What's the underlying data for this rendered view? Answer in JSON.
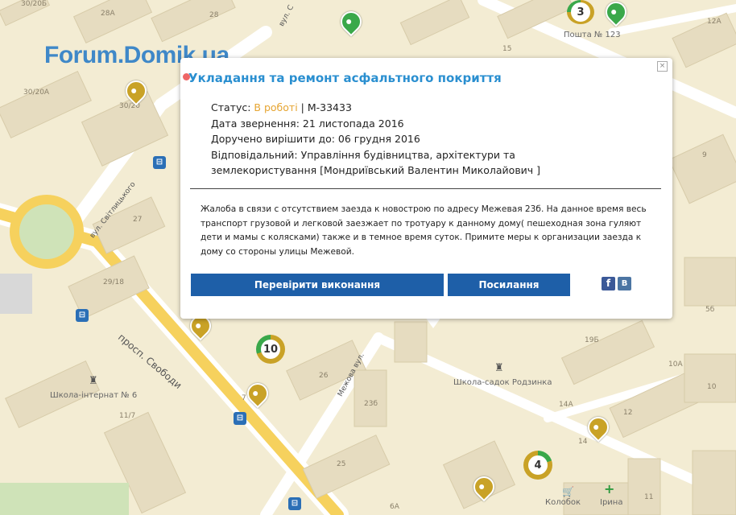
{
  "watermark": "Forum.Domik.ua",
  "map": {
    "house_numbers": [
      "30/20Б",
      "28А",
      "28",
      "30/20А",
      "30/20",
      "27",
      "29/18",
      "11/7",
      "26",
      "23б",
      "25",
      "6А",
      "15",
      "12А",
      "9",
      "19Б",
      "10А",
      "10",
      "14А",
      "12",
      "14",
      "11",
      "5б",
      "7"
    ],
    "streets": [
      "вул. Світлицького",
      "просп. Свободи",
      "Межова вул.",
      "вул. С"
    ],
    "pois": {
      "post_office": "Пошта № 123",
      "school": "Школа-інтернат № 6",
      "kindergarten": "Школа-садок Родзинка",
      "store": "Колобок",
      "pharmacy": "Ірина"
    },
    "clusters": [
      "3",
      "10",
      "4"
    ]
  },
  "popup": {
    "title": "Укладання та ремонт асфальтного покриття",
    "status_label": "Статус:",
    "status_value": "В роботі",
    "separator": "|",
    "id": "М-33433",
    "date_line": "Дата звернення: 21 листопада 2016",
    "deadline_line": "Доручено вирішити до: 06 грудня 2016",
    "responsible_line1": "Відповідальний: Управління будівництва, архітектури та",
    "responsible_line2": "землекористування [Мондриївський Валентин Миколайович ]",
    "description": "Жалоба в связи с отсутствием заезда к новострою по адресу Межевая 23б. На данное время весь транспорт грузовой и легковой заезжает по тротуару к данному дому( пешеходная зона гуляют дети и мамы с колясками) также и в темное время суток. Примите меры к организации заезда к дому со стороны улицы Межевой.",
    "check_button": "Перевірити виконання",
    "link_button": "Посилання",
    "close_symbol": "×",
    "facebook_letter": "f",
    "vk_letter": "B"
  },
  "colors": {
    "accent": "#2a8fd0",
    "status": "#e6a532",
    "button": "#1e5fa8",
    "facebook": "#3b5998",
    "vk": "#4c75a3",
    "pin_green": "#3aa84a",
    "pin_gold": "#c9a227"
  }
}
